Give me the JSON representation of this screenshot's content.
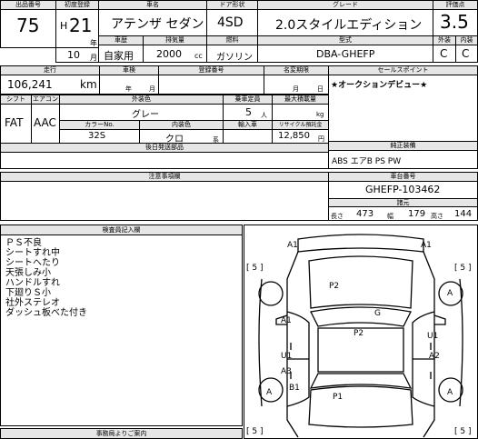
{
  "header": {
    "lot_no_label": "出品番号",
    "lot_no": "75",
    "first_reg_label": "初度登録",
    "era": "H",
    "year": "21",
    "year_unit": "年",
    "month": "10",
    "month_unit": "月",
    "car_name_label": "車名",
    "car_name": "アテンザ セダン",
    "door_label": "ドア形状",
    "door": "4SD",
    "grade_label": "グレード",
    "grade": "2.0スタイルエディション",
    "score_label": "評価点",
    "score": "3.5",
    "usage_label": "車歴",
    "usage": "自家用",
    "displacement_label": "排気量",
    "displacement": "2000",
    "displacement_unit": "cc",
    "fuel_label": "燃料",
    "fuel": "ガソリン",
    "model_label": "型式",
    "model": "DBA-GHEFP",
    "ext_label": "外装",
    "ext": "C",
    "int_label": "内装",
    "int": "C"
  },
  "row2": {
    "mileage_label": "走行",
    "mileage": "106,241",
    "mileage_unit": "km",
    "inspection_label": "車検",
    "insp_year_unit": "年",
    "insp_month_unit": "月",
    "reg_no_label": "登録番号",
    "name_change_label": "名変期限",
    "nc_month_unit": "月",
    "nc_day_unit": "日",
    "selling_point_label": "セールスポイント",
    "selling_point": "★オークションデビュー★"
  },
  "row3": {
    "shift_label": "シフト",
    "shift": "FAT",
    "ac_label": "エアコン",
    "ac": "AAC",
    "ext_color_label": "外装色",
    "ext_color": "グレー",
    "capacity_label": "乗車定員",
    "capacity": "5",
    "capacity_unit": "人",
    "max_load_label": "最大積載量",
    "max_load_unit": "kg",
    "color_no_label": "カラーNo.",
    "color_no": "32S",
    "int_color_label": "内装色",
    "int_color": "クロ",
    "int_color_suffix": "系",
    "import_label": "輸入車",
    "recycle_label": "リサイクル預託金",
    "recycle_fee": "12,850",
    "recycle_unit": "円"
  },
  "later_parts_label": "後日発送部品",
  "equipment_label": "純正装備",
  "equipment": "ABS エアB PS PW",
  "notes_label": "注意事項欄",
  "chassis_label": "車台番号",
  "chassis_no": "GHEFP-103462",
  "dims_label": "諸元",
  "length_label": "長さ",
  "length": "473",
  "width_label": "幅",
  "width": "179",
  "height_label": "高さ",
  "height": "144",
  "inspector_label": "検査員記入欄",
  "inspector_notes": [
    "ＰＳ不良",
    "シートすれ中",
    "シートへたり",
    "天張しみ小",
    "ハンドルすれ",
    "下廻りＳ小",
    "社外ステレオ",
    "ダッシュ板べた付き"
  ],
  "office_label": "事務局よりご案内",
  "diagram": {
    "bracket_left": "[ 5 ]",
    "bracket_right": "[ 5 ]",
    "bracket_bl": "[ 5 ]",
    "bracket_br": "[ 5 ]",
    "marks": {
      "a1_top_left": "A1",
      "a1_top_right": "A1",
      "p2_hood": "P2",
      "g_windshield": "G",
      "a_right_front": "A",
      "a1_left_front": "A1",
      "p2_roof": "P2",
      "u1_right": "U1",
      "a2_right": "A2",
      "u1_left": "U1",
      "a3_left": "A3",
      "a_left_rear": "A",
      "b1_left": "B1",
      "p1_trunk": "P1",
      "a_right_rear": "A"
    }
  }
}
